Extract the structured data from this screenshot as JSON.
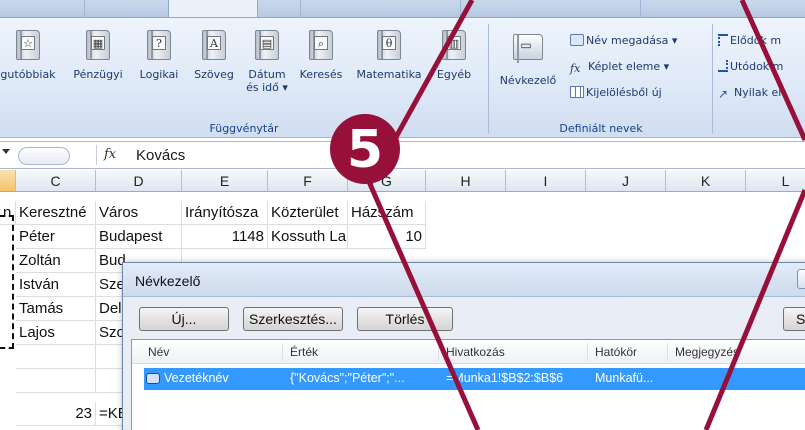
{
  "ribbon": {
    "function_library": {
      "group_label": "Függvénytár",
      "buttons": [
        {
          "label": "gutóbbiak",
          "icon": "star-book-icon"
        },
        {
          "label": "Pénzügyi",
          "icon": "money-book-icon"
        },
        {
          "label": "Logikai",
          "icon": "question-book-icon"
        },
        {
          "label": "Szöveg",
          "icon": "text-book-icon"
        },
        {
          "label": "Dátum",
          "label2": "és idő ▾",
          "icon": "calendar-book-icon"
        },
        {
          "label": "Keresés",
          "icon": "lookup-book-icon"
        },
        {
          "label": "Matematika",
          "icon": "theta-book-icon"
        },
        {
          "label": "Egyéb",
          "icon": "more-books-icon"
        }
      ]
    },
    "defined_names": {
      "group_label": "Definiált nevek",
      "name_manager_label": "Névkezelő",
      "define_name_label": "Név megadása ▾",
      "use_in_formula_label": "Képlet eleme ▾",
      "create_from_selection_label": "Kijelölésből új"
    },
    "formula_auditing": {
      "precedents_label": "Elődök m",
      "dependents_label": "Utódok m",
      "remove_arrows_label": "Nyilak elt"
    }
  },
  "formula_bar": {
    "fx_label": "fx",
    "value": "Kovács"
  },
  "sheet": {
    "columns": [
      "C",
      "D",
      "E",
      "F",
      "G",
      "H",
      "I",
      "J",
      "K",
      "L"
    ],
    "selected_column": "B",
    "rows": [
      {
        "b": "n",
        "c": "Keresztné",
        "d": "Város",
        "e": "Irányítósza",
        "f": "Közterület",
        "g": "Házszám"
      },
      {
        "c": "Péter",
        "d": "Budapest",
        "e": "1148",
        "f": "Kossuth La",
        "g": "10"
      },
      {
        "c": "Zoltán",
        "d": "Bud"
      },
      {
        "c": "István",
        "d": "Sze"
      },
      {
        "c": "Tamás",
        "d": "Del"
      },
      {
        "c": "Lajos",
        "d": "Szo"
      },
      {},
      {
        "c": "23",
        "d": "=KE"
      }
    ]
  },
  "name_manager": {
    "title": "Névkezelő",
    "new_button": "Új...",
    "edit_button": "Szerkesztés...",
    "delete_button": "Törlés",
    "right_button": "S",
    "headers": {
      "name": "Név",
      "value": "Érték",
      "refers_to": "Hivatkozás",
      "scope": "Hatókör",
      "comment": "Megjegyzés"
    },
    "entries": [
      {
        "name": "Vezetéknév",
        "value": "{\"Kovács\";\"Péter\";\"...",
        "refers_to": "=Munka1!$B$2:$B$6",
        "scope": "Munkafü...",
        "comment": ""
      }
    ]
  },
  "step_marker": "5",
  "colors": {
    "marker": "#97103a",
    "selection_row": "#3399ff",
    "ribbon_text": "#15428b"
  }
}
